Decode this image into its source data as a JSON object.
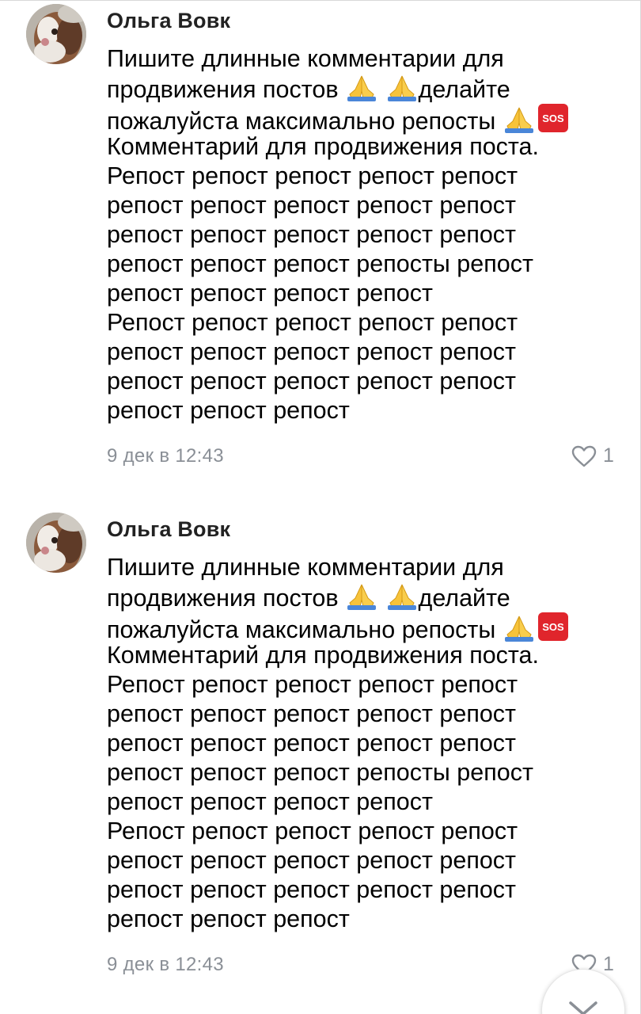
{
  "comments": [
    {
      "author": "Ольга Вовк",
      "lines": [
        "Пишите длинные комментарии для",
        "продвижения постов",
        "делайте",
        "пожалуйста максимально репосты",
        "Комментарий для продвижения поста.",
        "Репост репост репост репост репост",
        "репост репост репост репост репост",
        "репост репост репост репост репост",
        "репост репост репост репосты репост",
        "репост репост репост репост",
        "Репост репост репост репост репост",
        "репост репост репост репост репост",
        "репост репост репост репост репост",
        "репост репост репост"
      ],
      "date": "9 дек в 12:43",
      "likes": "1"
    },
    {
      "author": "Ольга Вовк",
      "lines": [
        "Пишите длинные комментарии для",
        "продвижения постов",
        "делайте",
        "пожалуйста максимально репосты",
        "Комментарий для продвижения поста.",
        "Репост репост репост репост репост",
        "репост репост репост репост репост",
        "репост репост репост репост репост",
        "репост репост репост репосты репост",
        "репост репост репост репост",
        "Репост репост репост репост репост",
        "репост репост репост репост репост",
        "репост репост репост репост репост",
        "репост репост репост"
      ],
      "date": "9 дек в 12:43",
      "likes": "1"
    }
  ],
  "icons": {
    "emoji": "folded-hands",
    "sos": "SOS",
    "like": "heart-outline",
    "scroll": "chevron-down"
  },
  "colors": {
    "meta_text": "#8a8f96",
    "sos_red": "#e0252c",
    "emoji_yellow": "#f7c33a"
  }
}
